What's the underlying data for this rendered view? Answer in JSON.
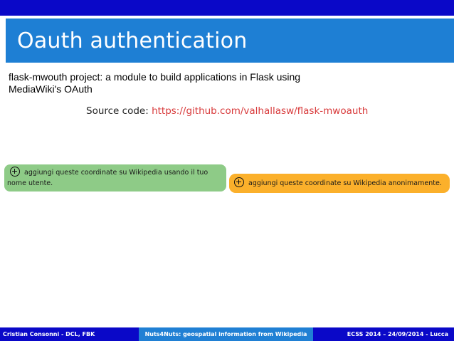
{
  "slide": {
    "title": "Oauth authentication",
    "description": "flask-mwouth project: a module to build applications in Flask using MediaWiki's OAuth",
    "source_label": "Source code: ",
    "source_url": "https://github.com/valhallasw/flask-mwoauth"
  },
  "buttons": {
    "green_icon": "plus-circle-icon",
    "green_label": "aggiungi queste coordinate su Wikipedia usando il tuo nome utente.",
    "orange_icon": "plus-circle-icon",
    "orange_label": "aggiungi queste coordinate su Wikipedia anonimamente."
  },
  "footer": {
    "left": "Cristian Consonni - DCL, FBK",
    "center": "Nuts4Nuts: geospatial information from Wikipedia",
    "right": "ECSS 2014 – 24/09/2014 - Lucca"
  },
  "colors": {
    "dark_blue": "#0a08c8",
    "title_blue": "#1e7fd4",
    "link_red": "#d8393a",
    "green_button": "#8ecb87",
    "orange_button": "#fbb02b"
  }
}
